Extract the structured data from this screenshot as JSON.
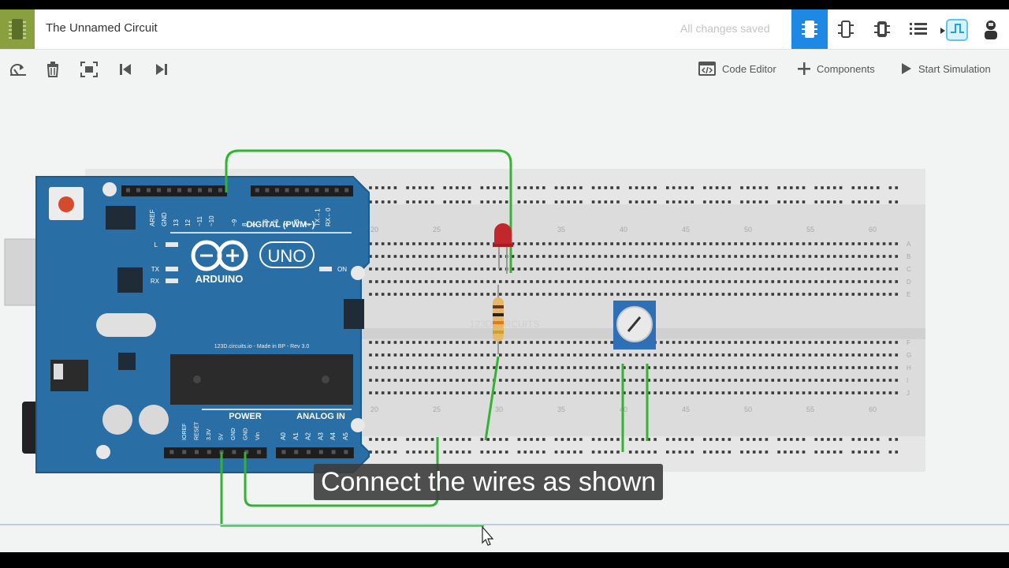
{
  "header": {
    "title": "The Unnamed Circuit",
    "save_status": "All changes saved",
    "view_buttons": [
      {
        "icon": "chip-icon",
        "active": true
      },
      {
        "icon": "component-icon",
        "active": false
      },
      {
        "icon": "breadboard-icon",
        "active": false
      },
      {
        "icon": "list-icon",
        "active": false
      },
      {
        "icon": "share-icon",
        "active": false
      }
    ]
  },
  "toolbar": {
    "left_buttons": [
      "rotate-icon",
      "delete-icon",
      "fit-view-icon",
      "undo-icon",
      "redo-icon"
    ],
    "code_editor_label": "Code Editor",
    "components_label": "Components",
    "start_simulation_label": "Start Simulation"
  },
  "arduino": {
    "brand": "ARDUINO",
    "model": "UNO",
    "digital_header": "DIGITAL (PWM~)",
    "power_header": "POWER",
    "analog_header": "ANALOG IN",
    "top_pins": [
      "AREF",
      "GND",
      "13",
      "12",
      "~11",
      "~10",
      "~9",
      "8",
      "7",
      "~6",
      "~5",
      "4",
      "~3",
      "2",
      "TX→1",
      "RX←0"
    ],
    "power_pins": [
      "IOREF",
      "RESET",
      "3.3V",
      "5V",
      "GND",
      "GND",
      "Vin"
    ],
    "analog_pins": [
      "A0",
      "A1",
      "A2",
      "A3",
      "A4",
      "A5"
    ],
    "led_labels": [
      "L",
      "TX",
      "RX"
    ],
    "on_label": "ON",
    "footer_text": "123D.circuits.io - Made in BP - Rev 3.0"
  },
  "breadboard": {
    "col_numbers": [
      "20",
      "25",
      "30",
      "35",
      "40",
      "45",
      "50",
      "55",
      "60"
    ],
    "row_letters_top": [
      "A",
      "B",
      "C",
      "D",
      "E"
    ],
    "row_letters_bottom": [
      "F",
      "G",
      "H",
      "I",
      "J"
    ],
    "watermark": "123D CIRCUITS"
  },
  "colors": {
    "accent": "#1e88e5",
    "wire": "#34b233",
    "arduino_blue": "#2a6ea6",
    "logo_green": "#8aa03f"
  },
  "caption": "Connect the wires as shown"
}
